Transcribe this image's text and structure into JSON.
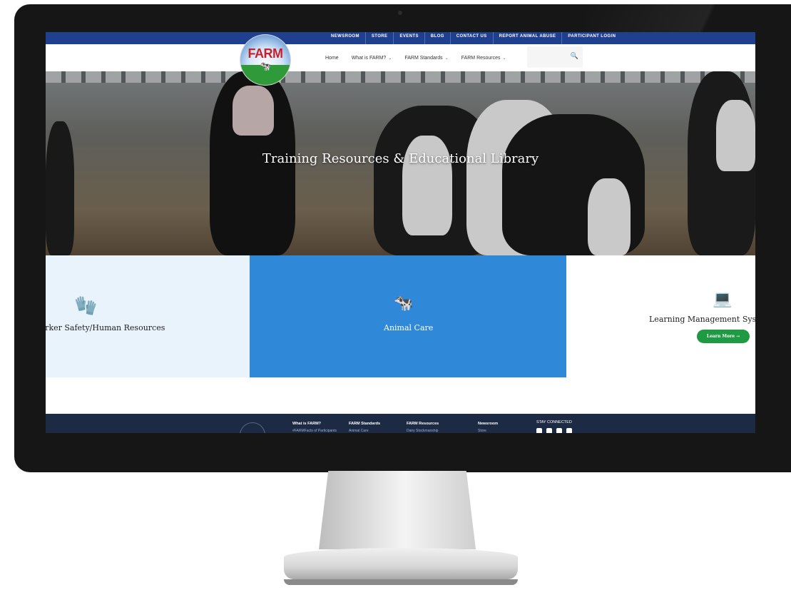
{
  "utility_nav": [
    "NEWSROOM",
    "STORE",
    "EVENTS",
    "BLOG",
    "CONTACT US",
    "REPORT ANIMAL ABUSE",
    "PARTICIPANT LOGIN"
  ],
  "logo_text": "FARM",
  "main_nav": {
    "home": "Home",
    "what_is_farm": "What is FARM?",
    "standards": "FARM Standards",
    "resources": "FARM Resources",
    "chevron": "⌄"
  },
  "search_icon": "🔍",
  "hero": {
    "title": "Training Resources & Educational Library"
  },
  "cards": [
    {
      "label": "Worker Safety/Human Resources",
      "icon": "gloves-icon",
      "icon_glyph": "🧤"
    },
    {
      "label": "Animal Care",
      "icon": "cow-hand-icon",
      "icon_glyph": "🐄"
    },
    {
      "label": "Learning Management System",
      "icon": "laptop-icon",
      "icon_glyph": "💻",
      "button": "Learn More →"
    }
  ],
  "footer": {
    "columns": [
      {
        "title": "What is FARM?",
        "sub": "#FARMFacts of Participants"
      },
      {
        "title": "FARM Standards",
        "sub": "Animal Care"
      },
      {
        "title": "FARM Resources",
        "sub": "Dairy Stockmanship"
      },
      {
        "title": "Newsroom",
        "sub": "Store"
      }
    ],
    "stay_connected": "STAY CONNECTED"
  },
  "colors": {
    "utility_bar": "#1f3f8f",
    "card_accent": "#2f88d8",
    "button_green": "#1f9a43",
    "footer": "#1d2a44"
  }
}
